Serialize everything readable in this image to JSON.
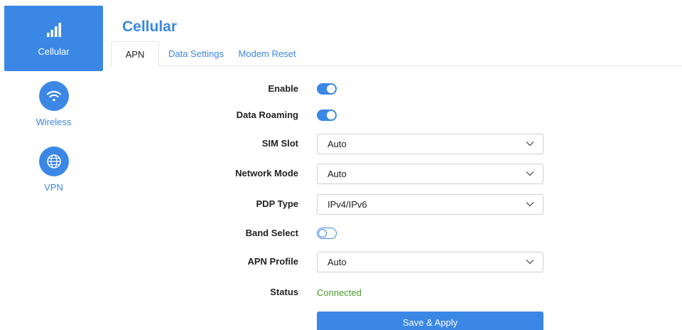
{
  "sidebar": {
    "items": [
      {
        "label": "Cellular",
        "icon": "signal-bars-icon",
        "active": true
      },
      {
        "label": "Wireless",
        "icon": "wifi-icon",
        "active": false
      },
      {
        "label": "VPN",
        "icon": "globe-icon",
        "active": false
      }
    ]
  },
  "page": {
    "title": "Cellular"
  },
  "tabs": [
    {
      "label": "APN",
      "active": true
    },
    {
      "label": "Data Settings",
      "active": false
    },
    {
      "label": "Modem Reset",
      "active": false
    }
  ],
  "form": {
    "enable": {
      "label": "Enable",
      "value": true
    },
    "data_roaming": {
      "label": "Data Roaming",
      "value": true
    },
    "sim_slot": {
      "label": "SIM Slot",
      "value": "Auto"
    },
    "network_mode": {
      "label": "Network Mode",
      "value": "Auto"
    },
    "pdp_type": {
      "label": "PDP Type",
      "value": "IPv4/IPv6"
    },
    "band_select": {
      "label": "Band Select",
      "value": false
    },
    "apn_profile": {
      "label": "APN Profile",
      "value": "Auto"
    },
    "status": {
      "label": "Status",
      "value": "Connected"
    }
  },
  "actions": {
    "save_apply_label": "Save & Apply"
  },
  "colors": {
    "accent": "#3b87e6",
    "status_ok": "#4c9b2f"
  }
}
